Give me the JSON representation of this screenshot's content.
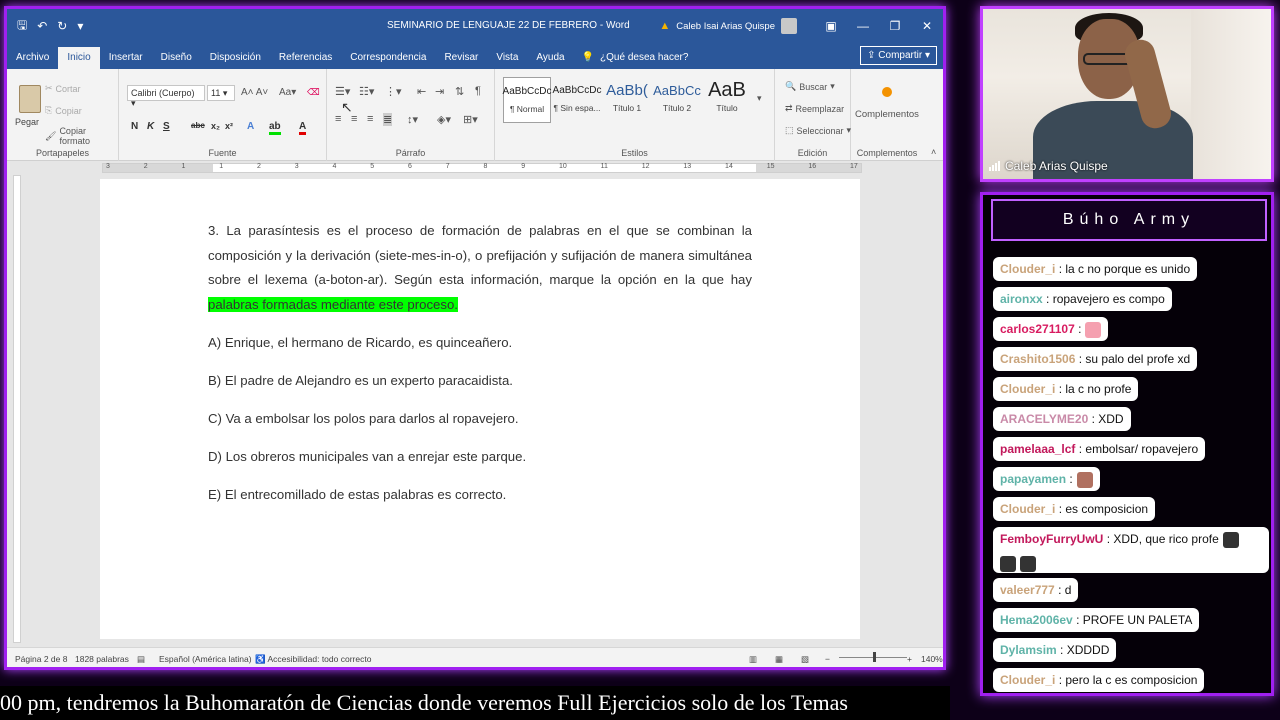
{
  "word": {
    "doc_title": "SEMINARIO DE LENGUAJE 22 DE FEBRERO",
    "app_name": "Word",
    "user_name": "Caleb Isai Arias Quispe",
    "tabs": [
      "Archivo",
      "Inicio",
      "Insertar",
      "Diseño",
      "Disposición",
      "Referencias",
      "Correspondencia",
      "Revisar",
      "Vista",
      "Ayuda"
    ],
    "tell_me": "¿Qué desea hacer?",
    "share": "Compartir",
    "ribbon": {
      "clipboard": {
        "paste": "Pegar",
        "cut": "Cortar",
        "copy": "Copiar",
        "format_painter": "Copiar formato",
        "label": "Portapapeles"
      },
      "font": {
        "name": "Calibri (Cuerpo)",
        "size": "11",
        "label": "Fuente"
      },
      "paragraph": {
        "label": "Párrafo"
      },
      "styles": {
        "items": [
          {
            "preview": "AaBbCcDc",
            "name": "¶ Normal"
          },
          {
            "preview": "AaBbCcDc",
            "name": "¶ Sin espa..."
          },
          {
            "preview": "AaBb(",
            "name": "Título 1"
          },
          {
            "preview": "AaBbCc",
            "name": "Título 2"
          },
          {
            "preview": "AaB",
            "name": "Título"
          }
        ],
        "label": "Estilos"
      },
      "editing": {
        "find": "Buscar",
        "replace": "Reemplazar",
        "select": "Seleccionar",
        "label": "Edición"
      },
      "addins": {
        "button": "Complementos",
        "label": "Complementos"
      }
    },
    "document": {
      "p1_a": "3. La parasíntesis es el proceso de formación de palabras en el que se combinan la composición y la derivación (siete-mes-in-o), o prefijación y sufijación de manera simultánea sobre el lexema (a-boton-ar). Según esta información, marque la opción en la que hay ",
      "p1_highlight": "palabras formadas mediante este proceso.",
      "options": [
        "A) Enrique, el hermano de Ricardo, es quinceañero.",
        "B) El padre de Alejandro es un experto paracaidista.",
        "C) Va a embolsar los polos para darlos al ropavejero.",
        "D) Los obreros municipales van a enrejar este parque.",
        "E) El entrecomillado de estas palabras es correcto."
      ]
    },
    "status": {
      "page": "Página 2 de 8",
      "words": "1828 palabras",
      "language": "Español (América latina)",
      "accessibility": "Accesibilidad: todo correcto",
      "zoom": "140%"
    }
  },
  "webcam": {
    "name": "Caleb Arias Quispe"
  },
  "chat": {
    "title": "Búho Army",
    "messages": [
      {
        "user": "Clouder_i",
        "text": ": la c no porque es unido",
        "color": "#c9a37a"
      },
      {
        "user": "aironxx",
        "text": ": ropavejero es compo",
        "color": "#5fb3a8"
      },
      {
        "user": "carlos271107",
        "text": ":",
        "color": "#d81b60",
        "emote": "#f5a0b0"
      },
      {
        "user": "Crashito1506",
        "text": ": su palo del profe xd",
        "color": "#c9a37a"
      },
      {
        "user": "Clouder_i",
        "text": ": la c no profe",
        "color": "#c9a37a"
      },
      {
        "user": "ARACELYME20",
        "text": ": XDD",
        "color": "#c98aa8"
      },
      {
        "user": "pamelaaa_lcf",
        "text": ": embolsar/ ropavejero",
        "color": "#c2185b"
      },
      {
        "user": "papayamen",
        "text": ":",
        "color": "#5fb3a8",
        "emote": "#b07060"
      },
      {
        "user": "Clouder_i",
        "text": ": es composicion",
        "color": "#c9a37a"
      },
      {
        "user": "FemboyFurryUwU",
        "text": ": XDD, que rico profe",
        "color": "#c2185b"
      },
      {
        "user": "valeer777",
        "text": ": d",
        "color": "#c9a37a"
      },
      {
        "user": "Hema2006ev",
        "text": ": PROFE UN PALETA",
        "color": "#5fb3a8"
      },
      {
        "user": "Dylamsim",
        "text": ": XDDDD",
        "color": "#5fb3a8"
      },
      {
        "user": "Clouder_i",
        "text": ": pero la c es composicion",
        "color": "#c9a37a"
      }
    ]
  },
  "ticker": "00 pm, tendremos la Buhomaratón de Ciencias donde veremos Full Ejercicios solo de los Temas"
}
